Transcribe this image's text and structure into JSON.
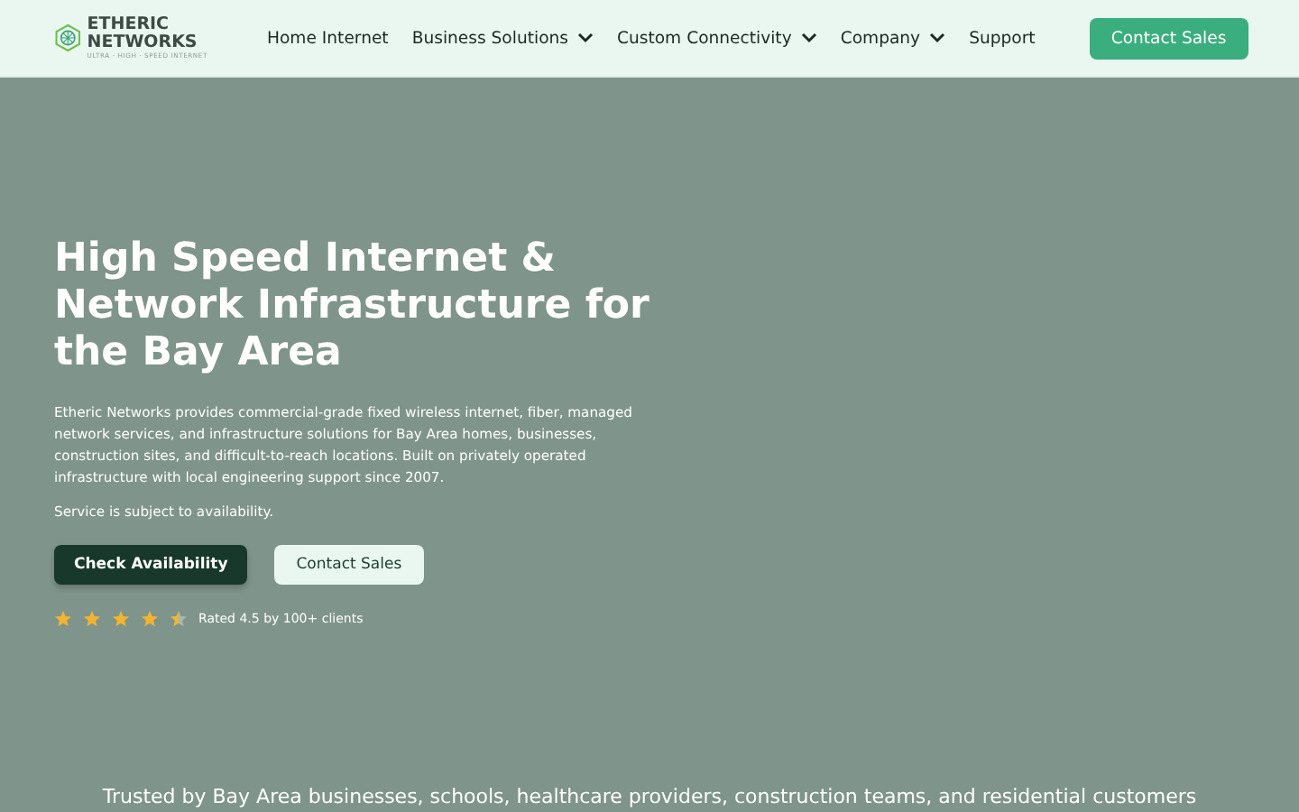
{
  "logo": {
    "name": "ETHERIC NETWORKS",
    "tagline": "ULTRA · HIGH · SPEED INTERNET"
  },
  "nav": [
    {
      "label": "Home Internet",
      "dropdown": false
    },
    {
      "label": "Business Solutions",
      "dropdown": true
    },
    {
      "label": "Custom Connectivity",
      "dropdown": true
    },
    {
      "label": "Company",
      "dropdown": true
    },
    {
      "label": "Support",
      "dropdown": false
    }
  ],
  "header_button": "Contact Sales",
  "hero": {
    "title": "High Speed Internet & Network Infrastructure for the Bay Area",
    "description": "Etheric Networks provides commercial-grade fixed wireless internet, fiber, managed network services, and infrastructure solutions for Bay Area homes, businesses, construction sites, and difficult-to-reach locations. Built on privately operated infrastructure with local engineering support since 2007.",
    "note": "Service is subject to availability.",
    "primary_button": "Check Availability",
    "secondary_button": "Contact Sales",
    "rating": {
      "stars": 4.5,
      "text": "Rated 4.5 by 100+ clients"
    }
  },
  "trusted": "Trusted by Bay Area businesses, schools, healthcare providers, construction teams, and residential customers"
}
